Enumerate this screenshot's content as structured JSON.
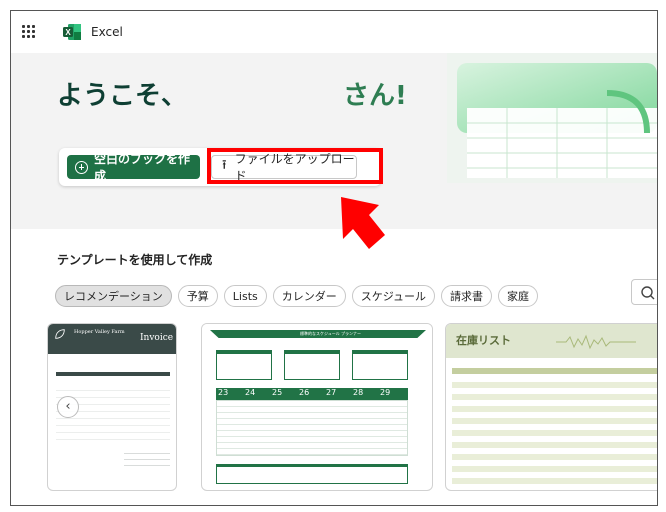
{
  "app": {
    "name": "Excel"
  },
  "hero": {
    "greeting_start": "ようこそ、",
    "greeting_end": "さん!",
    "new_blank_label": "空白のブックを作成",
    "upload_label": "ファイルをアップロード"
  },
  "templates": {
    "heading": "テンプレートを使用して作成",
    "chips": [
      "レコメンデーション",
      "予算",
      "Lists",
      "カレンダー",
      "スケジュール",
      "請求書",
      "家庭"
    ],
    "active_chip": "レコメンデーション",
    "cards": {
      "invoice": {
        "company": "Hopper Valley Farm",
        "title": "Invoice"
      },
      "schedule": {
        "title": "標準的なスケジュール プランナー",
        "days": [
          "23",
          "24",
          "25",
          "26",
          "27",
          "28",
          "29"
        ]
      },
      "inventory": {
        "title": "在庫リスト"
      }
    }
  },
  "colors": {
    "accent": "#1e7145",
    "highlight": "#ff0000",
    "greeting_dark": "#0e3f33",
    "greeting_green": "#2e7d52"
  },
  "icons": {
    "apps": "waffle-icon",
    "excel": "excel-logo-icon",
    "plus": "plus-circle-icon",
    "upload": "upload-icon",
    "search": "search-icon",
    "prev": "chevron-left-icon"
  }
}
